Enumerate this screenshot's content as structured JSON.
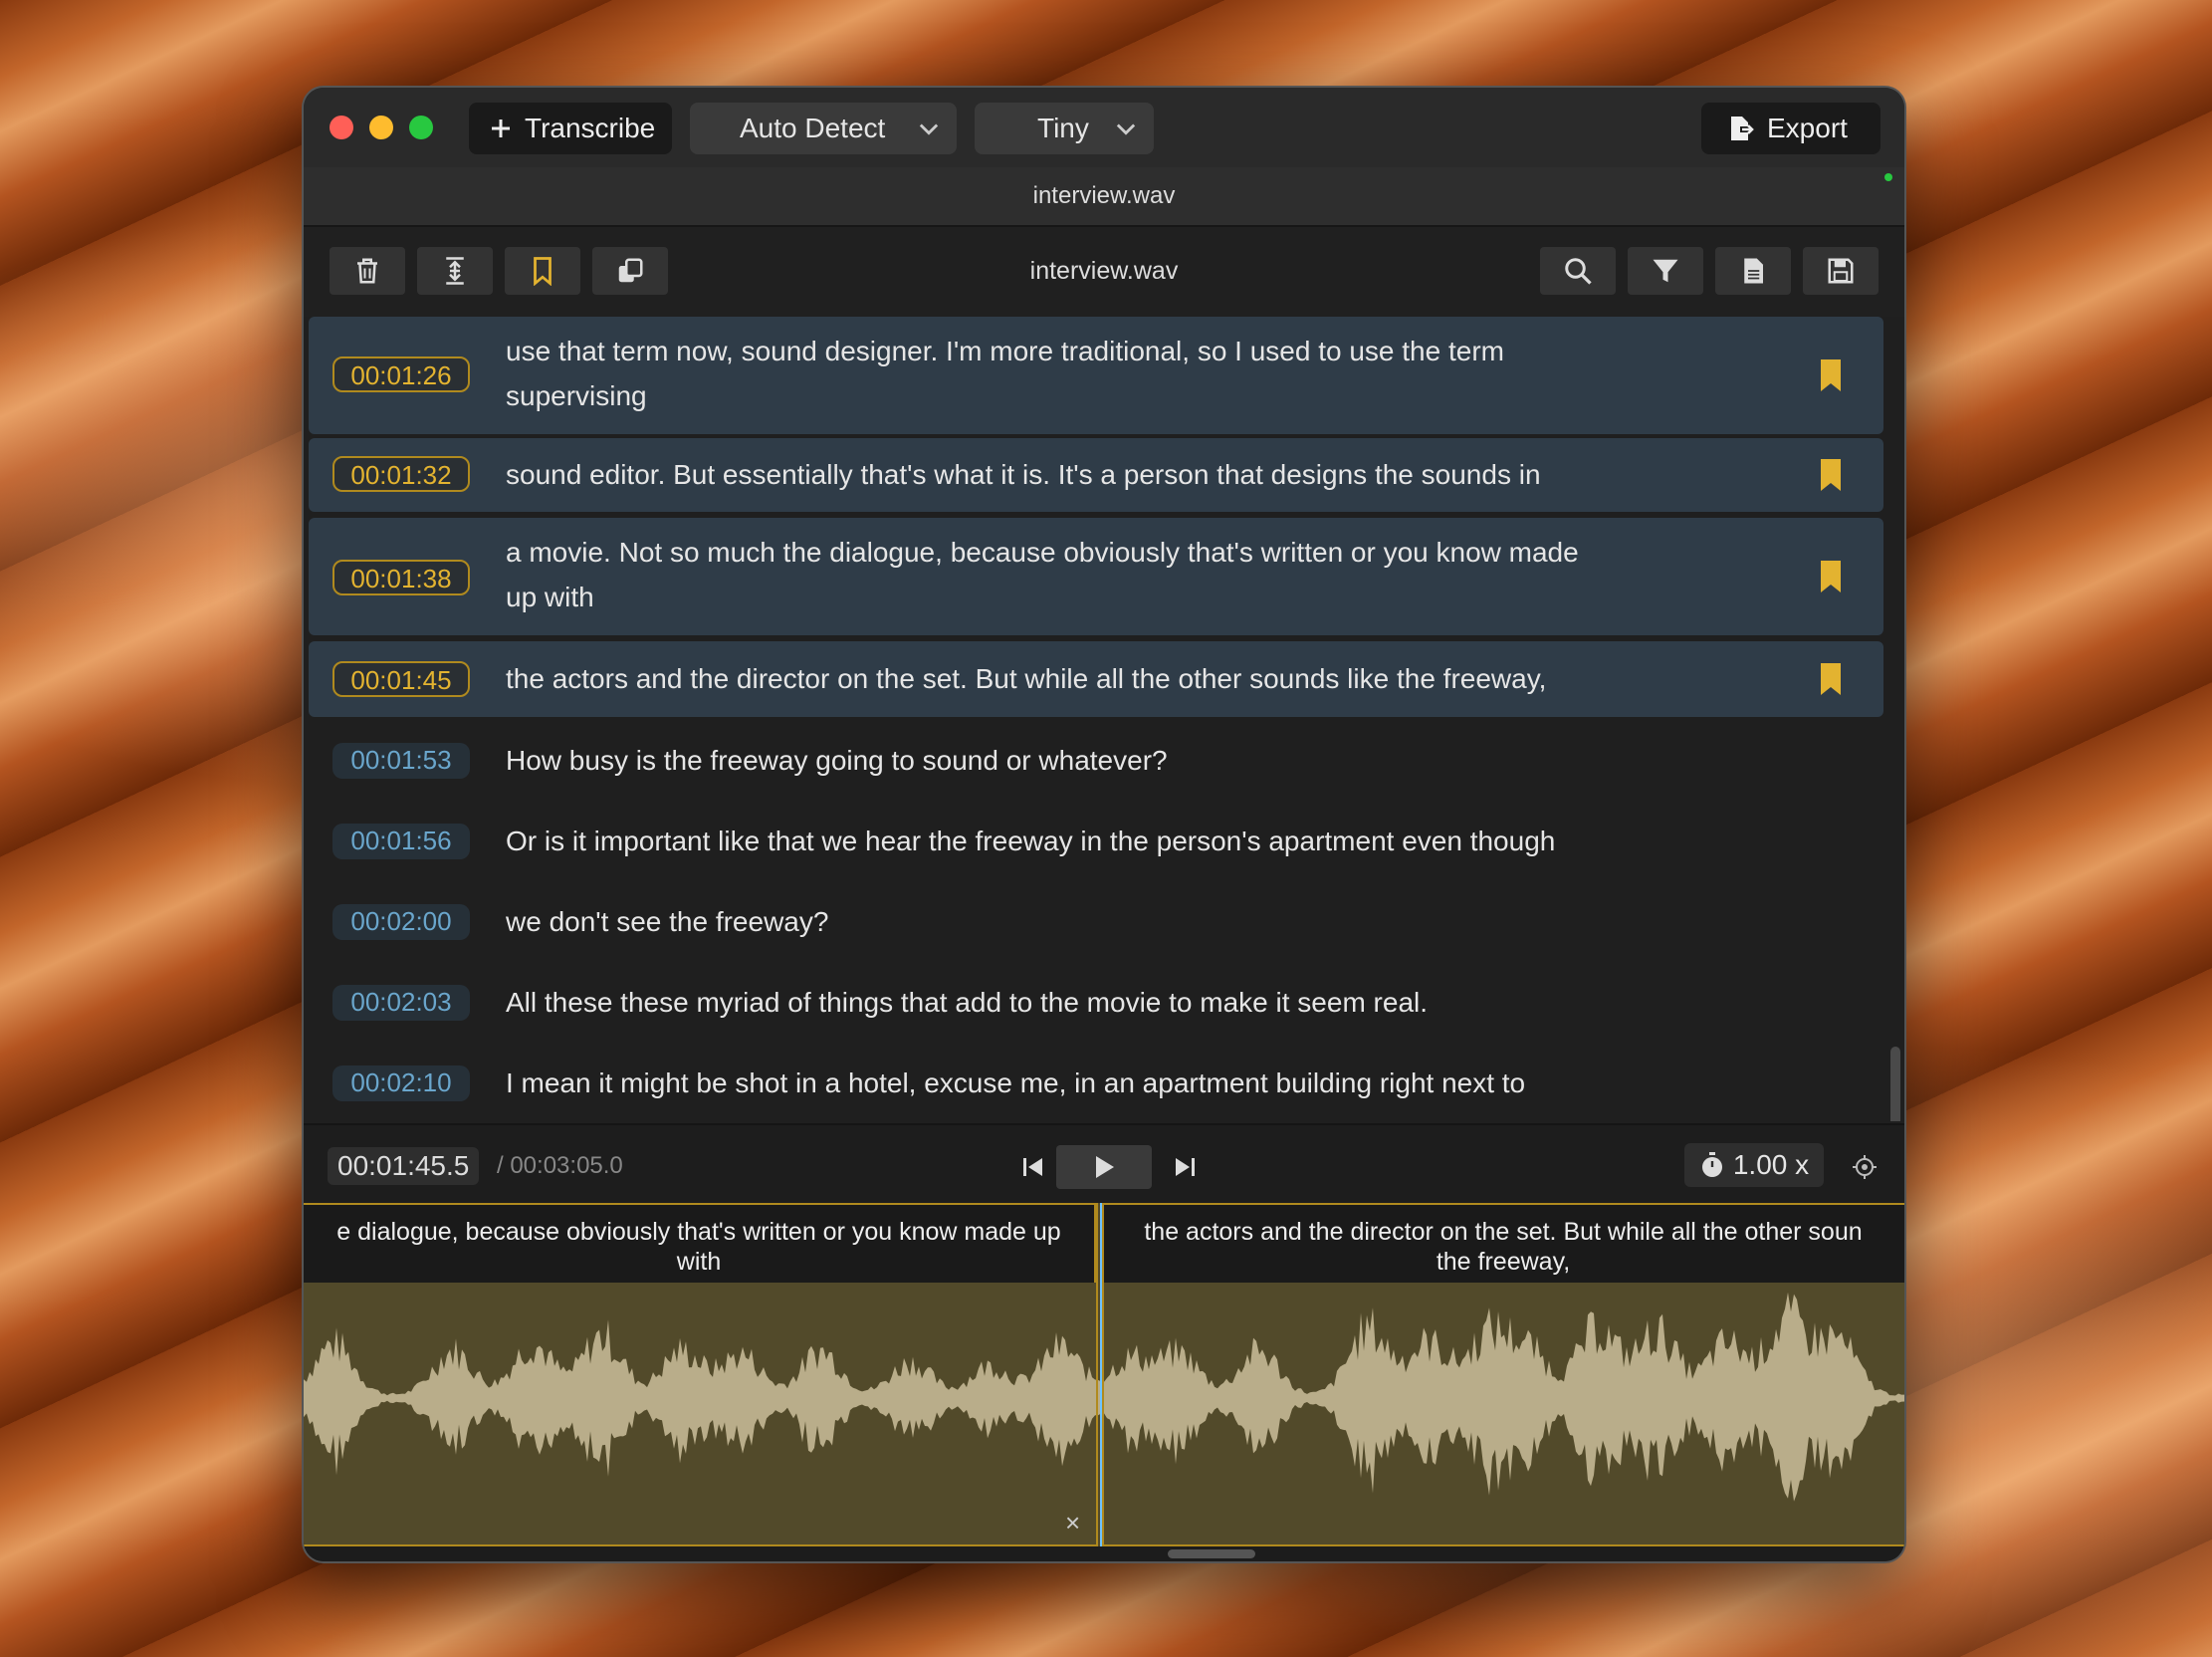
{
  "titlebar": {
    "transcribe_label": "Transcribe",
    "language_value": "Auto Detect",
    "model_value": "Tiny",
    "export_label": "Export"
  },
  "file_name": "interview.wav",
  "toolbar": {
    "title": "interview.wav"
  },
  "segments": [
    {
      "time": "00:01:26",
      "text_lines": [
        "use that term now, sound designer. I'm more traditional, so I used to use the term",
        "supervising"
      ],
      "bookmarked": true
    },
    {
      "time": "00:01:32",
      "text_lines": [
        "sound editor. But essentially that's what it is. It's a person that designs the sounds in"
      ],
      "bookmarked": true
    },
    {
      "time": "00:01:38",
      "text_lines": [
        "a movie. Not so much the dialogue, because obviously that's written or you know made",
        "up with"
      ],
      "bookmarked": true
    },
    {
      "time": "00:01:45",
      "text_lines": [
        "the actors and the director on the set. But while all the other sounds like the freeway,"
      ],
      "bookmarked": true
    },
    {
      "time": "00:01:53",
      "text_lines": [
        "How busy is the freeway going to sound or whatever?"
      ],
      "bookmarked": false
    },
    {
      "time": "00:01:56",
      "text_lines": [
        "Or is it important like that we hear the freeway in the person's apartment even though"
      ],
      "bookmarked": false
    },
    {
      "time": "00:02:00",
      "text_lines": [
        "we don't see the freeway?"
      ],
      "bookmarked": false
    },
    {
      "time": "00:02:03",
      "text_lines": [
        "All these these myriad of things that add to the movie to make it seem real."
      ],
      "bookmarked": false
    },
    {
      "time": "00:02:10",
      "text_lines": [
        "I mean it might be shot in a hotel, excuse me, in an apartment building right next to"
      ],
      "bookmarked": false
    }
  ],
  "transport": {
    "current_time": "00:01:45.5",
    "total_time": "/ 00:03:05.0",
    "speed": "1.00 x"
  },
  "waveform": {
    "left_caption_lines": [
      "e dialogue, because obviously that's written or you know made up",
      "with"
    ],
    "right_caption_lines": [
      "the actors and the director on the set. But while all the other soun",
      "the freeway,"
    ],
    "close_glyph": "×"
  },
  "colors": {
    "bookmark": "#e3b330",
    "timestamp_bookmarked": "#e3b330",
    "timestamp_normal": "#6aa6cc",
    "row_bookmarked_bg": "#2f3c48",
    "waveform_bg": "#524a2a",
    "waveform_fill": "#b9ad8a"
  },
  "icons": {
    "toolbar_left": [
      "trash-icon",
      "split-icon",
      "bookmark-icon",
      "copy-icon"
    ],
    "toolbar_right": [
      "search-icon",
      "filter-icon",
      "document-icon",
      "save-icon"
    ]
  }
}
